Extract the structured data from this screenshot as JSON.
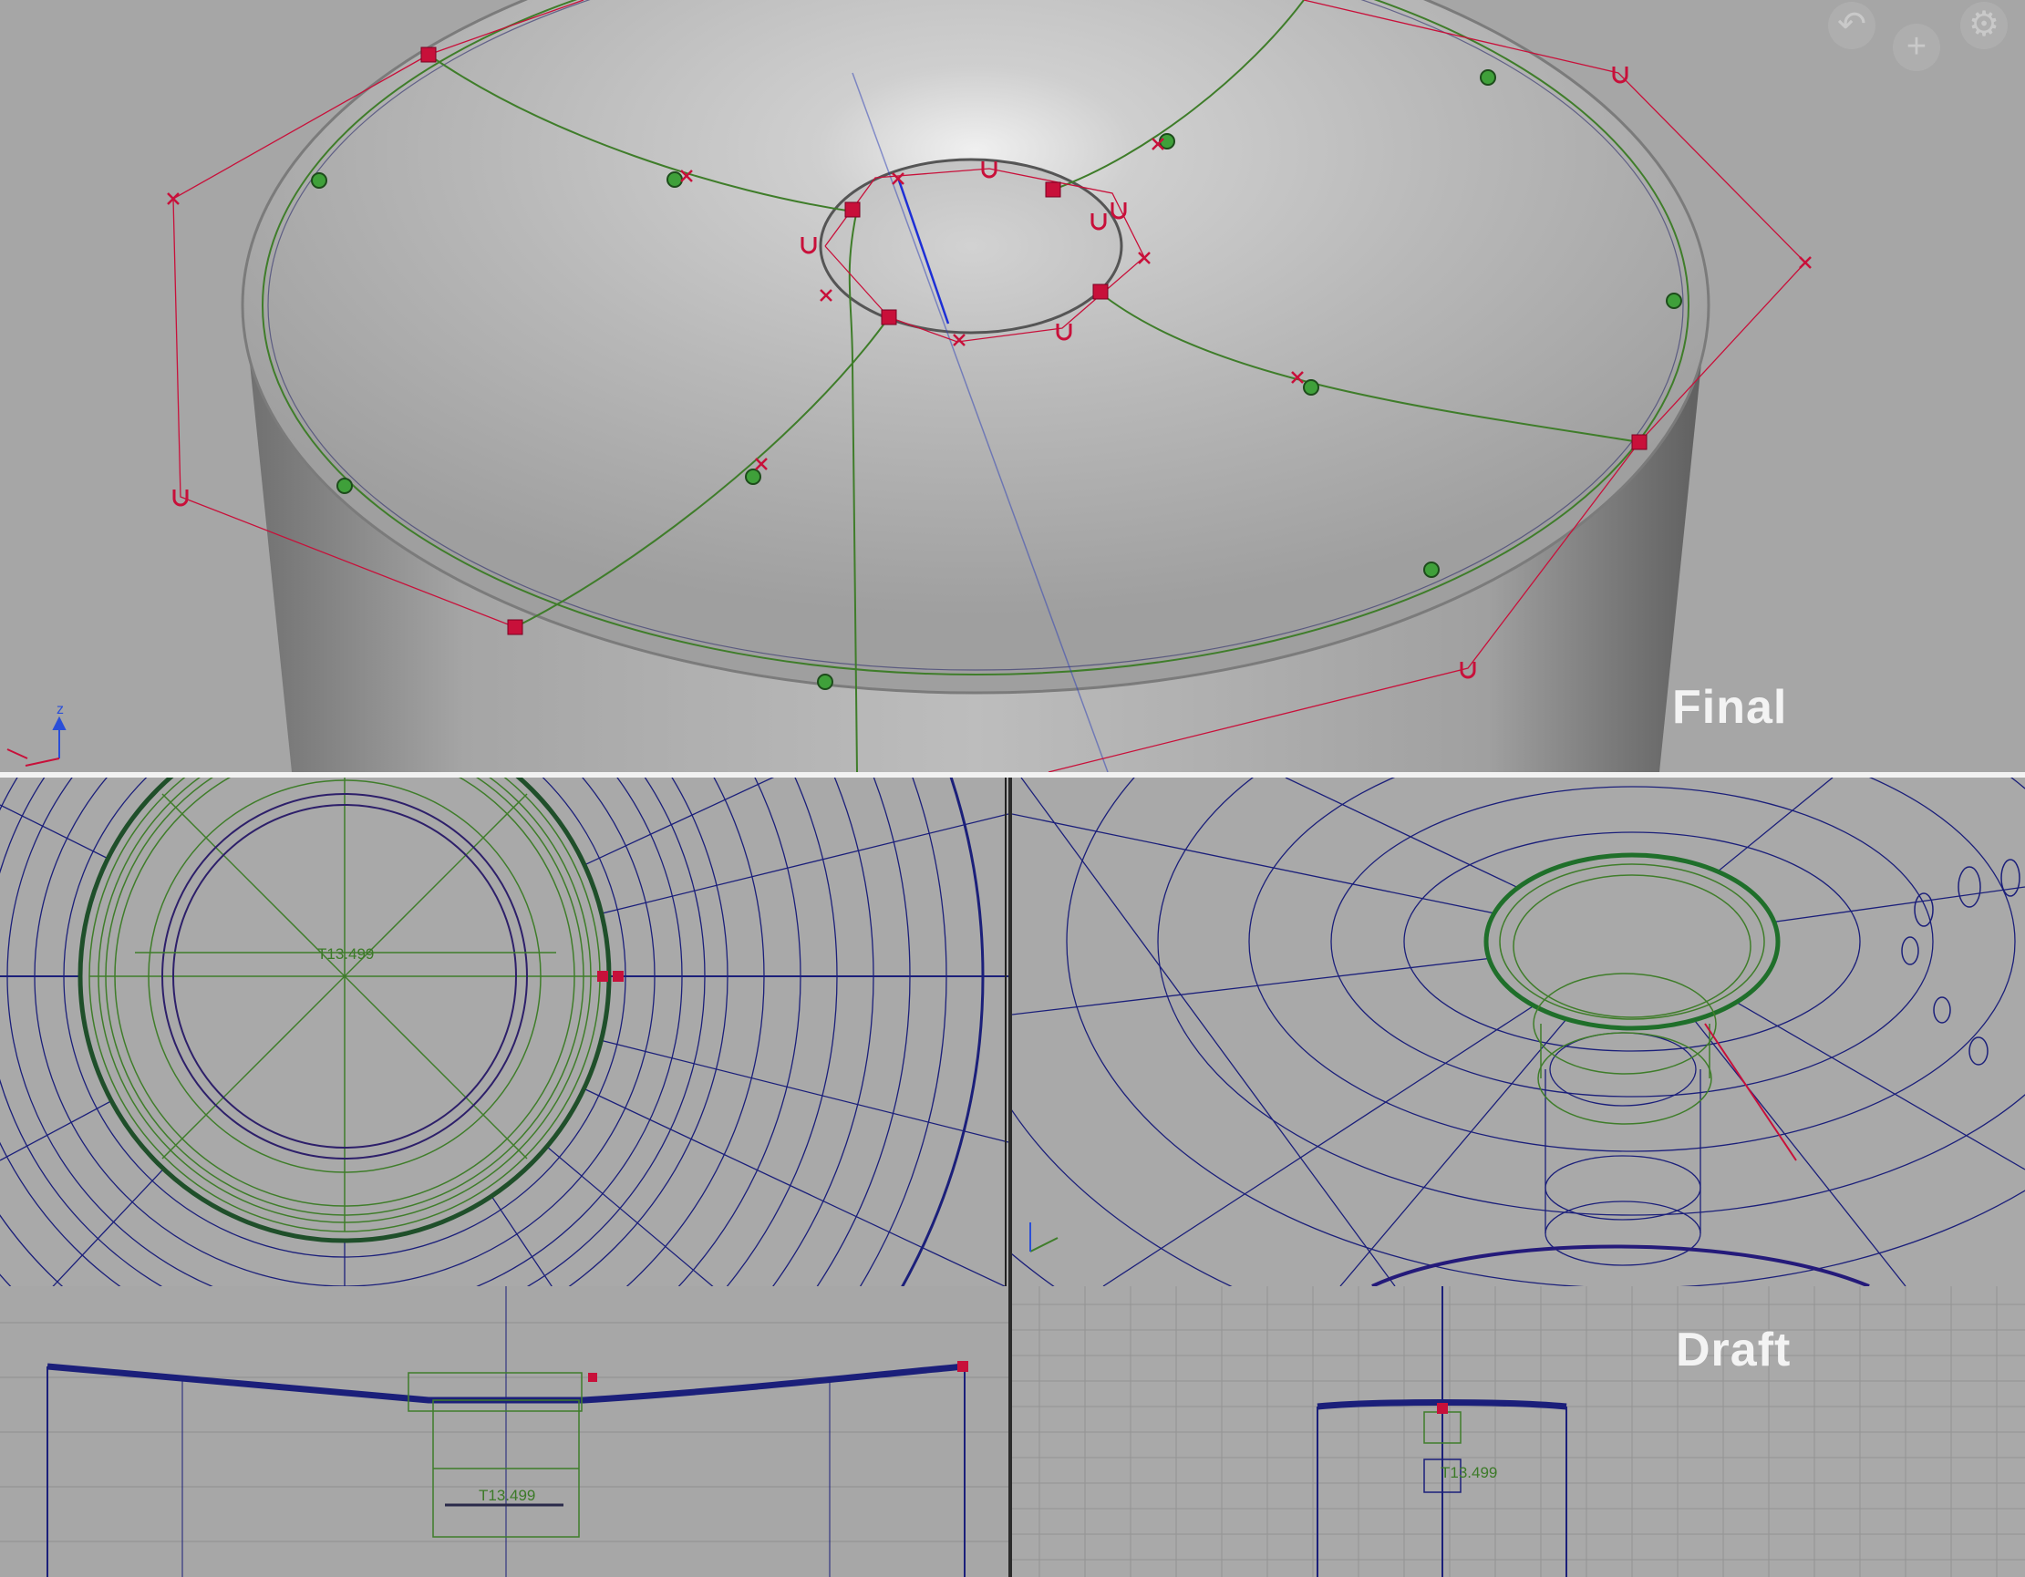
{
  "viewports": {
    "top": {
      "label": "Final",
      "axis_label": "z"
    },
    "bottom_right": {
      "label": "Draft"
    }
  },
  "annotations": {
    "dimension_left": "T13.499",
    "dimension_bottom_left": "T13.499",
    "dimension_bottom_right": "T13.499"
  },
  "toolbar": {
    "undo_icon": "undo-icon",
    "add_icon": "plus-icon",
    "settings_icon": "gear-icon"
  },
  "colors": {
    "curve_green": "#3f7d2a",
    "cv_red": "#c8103a",
    "wire_blue": "#1b1f7a",
    "viewport_grey": "#a9a9a9"
  }
}
